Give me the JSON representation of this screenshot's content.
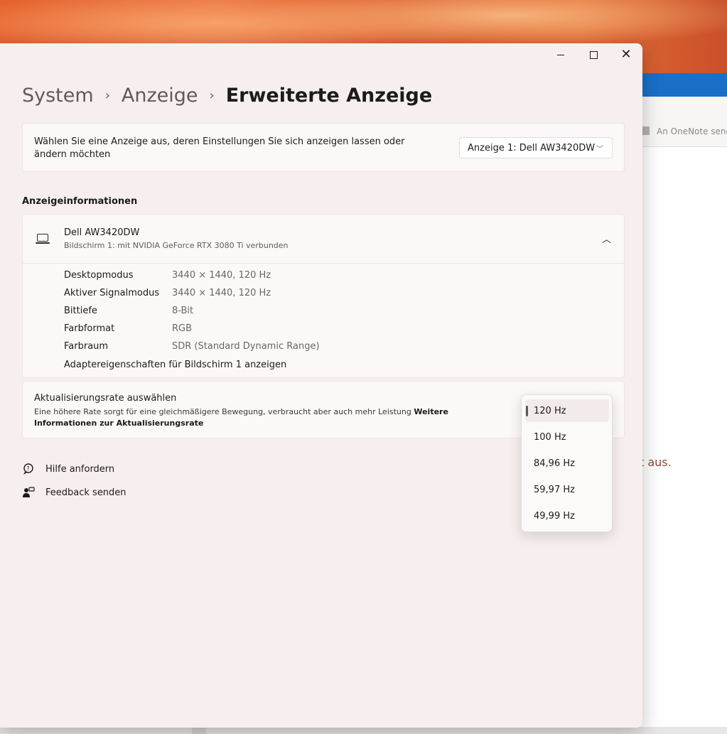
{
  "background": {
    "onenote_banner": "An OneNote send",
    "partial_text": "t aus."
  },
  "window": {
    "controls": {
      "minimize": "minimize",
      "maximize": "maximize",
      "close": "close"
    }
  },
  "breadcrumb": {
    "items": [
      "System",
      "Anzeige"
    ],
    "current": "Erweiterte Anzeige",
    "separator": "›"
  },
  "display_select": {
    "description": "Wählen Sie eine Anzeige aus, deren Einstellungen Sie sich anzeigen lassen oder ändern möchten",
    "selected": "Anzeige 1: Dell AW3420DW"
  },
  "display_info": {
    "section_title": "Anzeigeinformationen",
    "monitor_name": "Dell AW3420DW",
    "monitor_subtitle": "Bildschirm 1: mit NVIDIA GeForce RTX 3080 Ti verbunden",
    "rows": [
      {
        "label": "Desktopmodus",
        "value": "3440 × 1440, 120 Hz"
      },
      {
        "label": "Aktiver Signalmodus",
        "value": "3440 × 1440, 120 Hz"
      },
      {
        "label": "Bittiefe",
        "value": "8-Bit"
      },
      {
        "label": "Farbformat",
        "value": "RGB"
      },
      {
        "label": "Farbraum",
        "value": "SDR (Standard Dynamic Range)"
      }
    ],
    "adapter_link": "Adaptereigenschaften für Bildschirm 1 anzeigen"
  },
  "refresh_rate": {
    "title": "Aktualisierungsrate auswählen",
    "description": "Eine höhere Rate sorgt für eine gleichmäßigere Bewegung, verbraucht aber auch mehr Leistung",
    "more_info_link": "Weitere Informationen zur Aktualisierungsrate",
    "options": [
      "120 Hz",
      "100 Hz",
      "84,96 Hz",
      "59,97 Hz",
      "49,99 Hz"
    ],
    "selected": "120 Hz"
  },
  "footer_links": {
    "help": "Hilfe anfordern",
    "feedback": "Feedback senden"
  }
}
